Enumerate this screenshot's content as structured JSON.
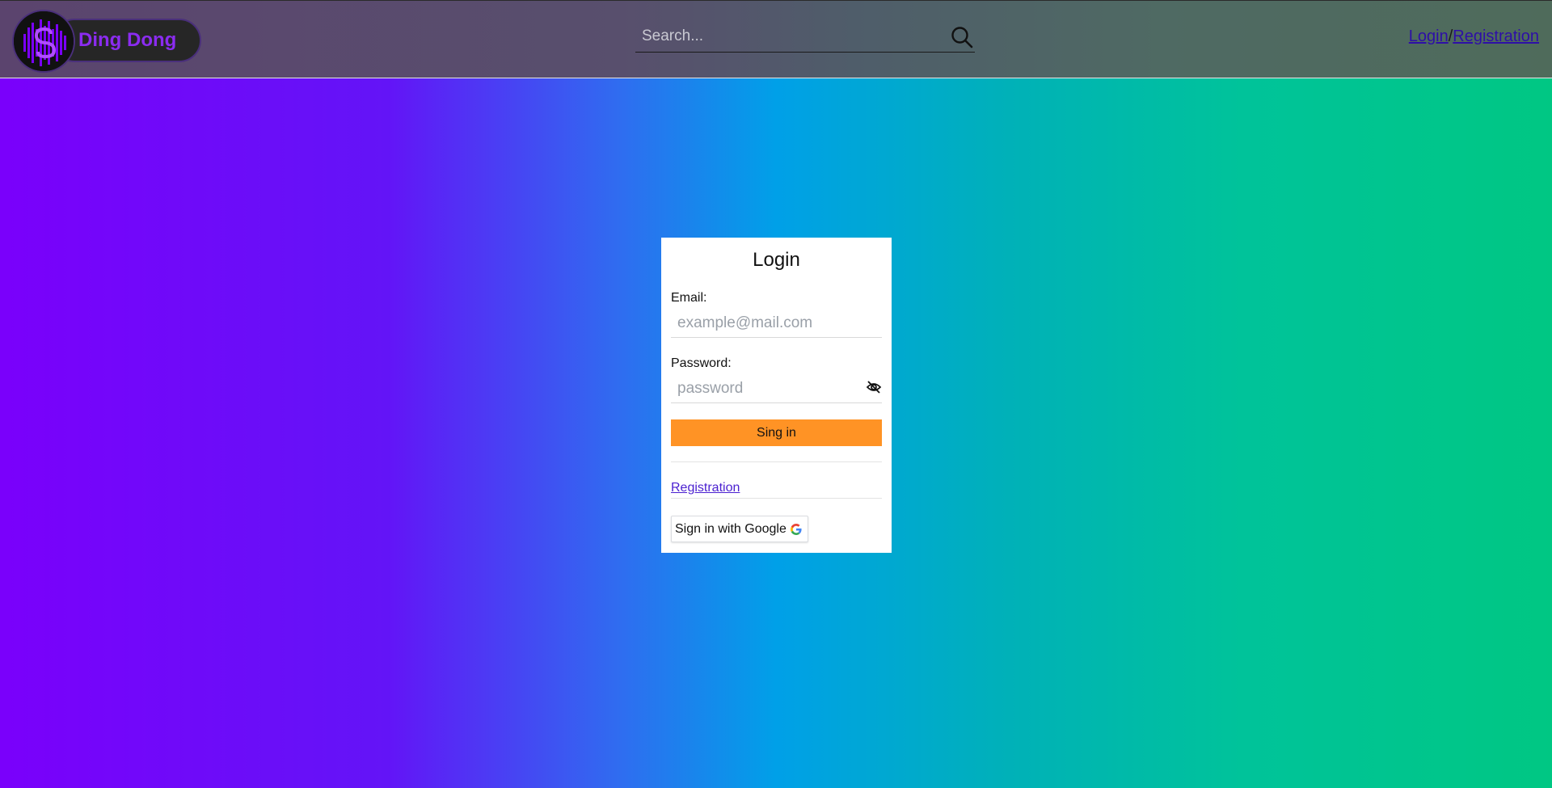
{
  "header": {
    "brand": "Ding Dong",
    "search": {
      "placeholder": "Search...",
      "value": ""
    },
    "auth": {
      "login_label": "Login",
      "separator": "/",
      "registration_label": "Registration"
    }
  },
  "login_card": {
    "title": "Login",
    "email": {
      "label": "Email:",
      "placeholder": "example@mail.com",
      "value": ""
    },
    "password": {
      "label": "Password:",
      "placeholder": "password",
      "value": ""
    },
    "signin_label": "Sing in",
    "registration_link": "Registration",
    "google_label": "Sign in with Google"
  },
  "colors": {
    "brand_purple": "#8b2cf0",
    "signin_orange": "#ff9325",
    "link_purple": "#4a1fd0"
  },
  "icons": {
    "logo": "sound-wave-logo-icon",
    "search": "magnifier-icon",
    "password_toggle": "eye-off-icon",
    "google": "google-g-icon"
  }
}
